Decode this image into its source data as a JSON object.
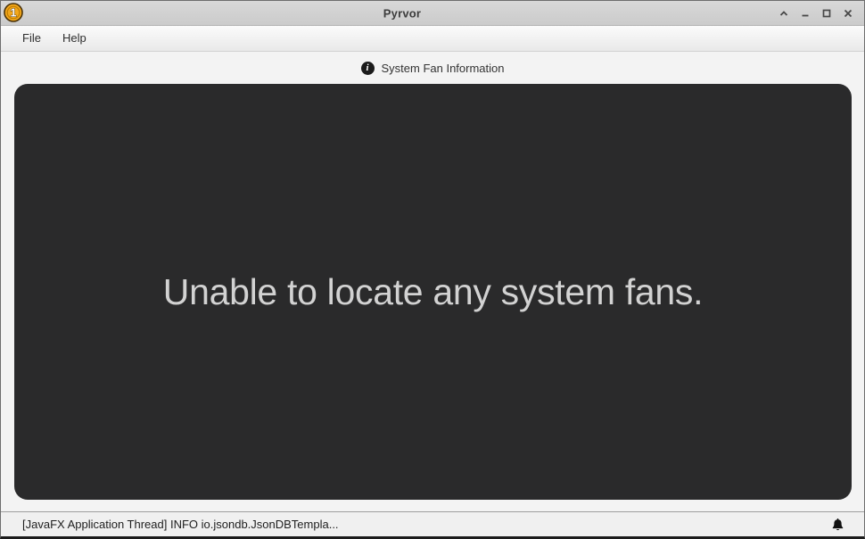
{
  "window": {
    "title": "Pyrvor",
    "controls": {
      "shade": "shade-icon",
      "minimize": "minimize-icon",
      "maximize": "maximize-icon",
      "close": "close-icon"
    },
    "app_icon": "coin-icon"
  },
  "menu": {
    "items": [
      "File",
      "Help"
    ]
  },
  "header": {
    "icon": "info-icon",
    "icon_glyph": "i",
    "title": "System Fan Information"
  },
  "main": {
    "message": "Unable to locate any system fans."
  },
  "status_bar": {
    "text": "[JavaFX Application Thread] INFO io.jsondb.JsonDBTempla...",
    "icon": "bell-icon"
  },
  "colors": {
    "titlebar_bg": "#d1d1d1",
    "panel_bg": "#2a2a2b",
    "panel_text": "#d2d2d2",
    "content_bg": "#f3f3f3",
    "statusbar_bg": "#f0f0f0",
    "coin_gold": "#f2a71b"
  }
}
